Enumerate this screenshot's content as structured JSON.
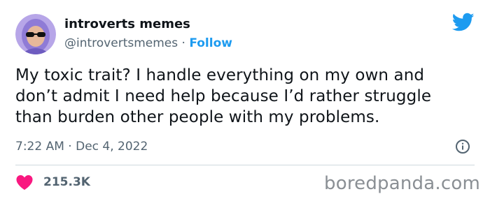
{
  "tweet": {
    "author": {
      "display_name": "introverts memes",
      "handle": "@introvertsmemes",
      "separator": "·",
      "follow_label": "Follow"
    },
    "text_lines": [
      "My toxic trait? I handle everything on my own and",
      "don’t admit I need help because I’d rather struggle",
      "than burden other people with my problems."
    ],
    "time": "7:22 AM",
    "date": "Dec 4, 2022",
    "likes": "215.3K"
  },
  "watermark": "boredpanda.com",
  "icons": {
    "brand": "twitter-bird-icon",
    "info": "info-icon",
    "like": "heart-icon"
  },
  "colors": {
    "accent": "#1d9bf0",
    "heart": "#f91880",
    "text": "#0f1419",
    "secondary": "#536471"
  }
}
